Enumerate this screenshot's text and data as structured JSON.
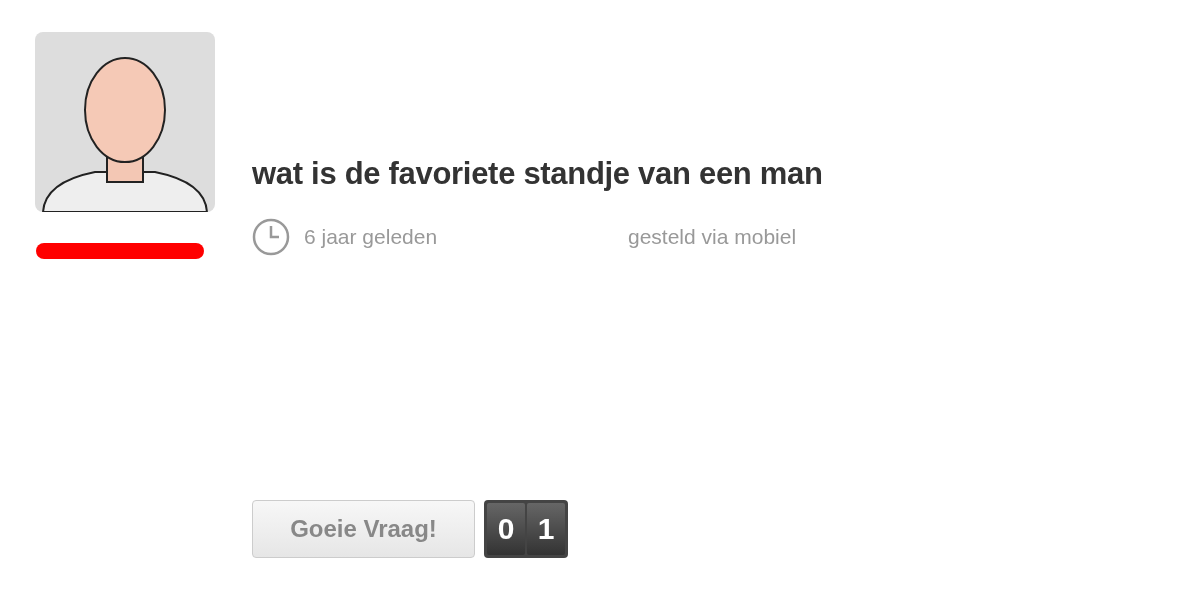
{
  "question": {
    "title": "wat is de favoriete standje van een man",
    "time": "6 jaar geleden",
    "source": "gesteld via mobiel"
  },
  "vote": {
    "button": "Goeie Vraag!",
    "counter": [
      "0",
      "1"
    ]
  }
}
